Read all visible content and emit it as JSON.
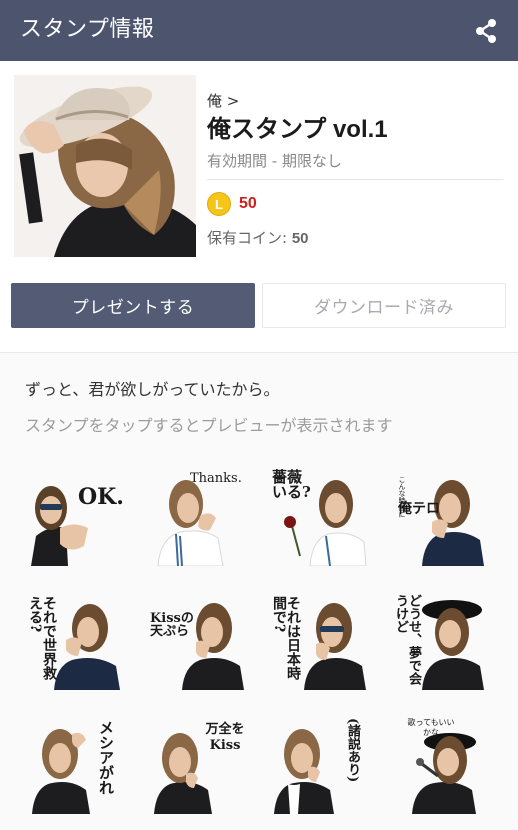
{
  "header": {
    "title": "スタンプ情報",
    "share_icon": "share-icon",
    "background": "#4c546e"
  },
  "product": {
    "author": "俺",
    "author_chevron": ">",
    "title": "俺スタンプ vol.1",
    "validity": "有効期間 - 期限なし",
    "coin_badge": "L",
    "price": "50",
    "holding_label": "保有コイン: ",
    "holding_value": "50",
    "price_color": "#cc2020"
  },
  "buttons": {
    "present": "プレゼントする",
    "downloaded": "ダウンロード済み"
  },
  "description": {
    "text": "ずっと、君が欲しがっていたから。",
    "hint": "スタンプをタップするとプレビューが表示されます"
  },
  "stickers": [
    {
      "caption": "OK."
    },
    {
      "caption": "Thanks."
    },
    {
      "caption": "薔薇いる?"
    },
    {
      "caption_small": "こんな時間に",
      "caption": "俺テロ"
    },
    {
      "caption": "それで世界救える?"
    },
    {
      "caption": "Kissの天ぷら"
    },
    {
      "caption": "それは日本時間で?"
    },
    {
      "caption": "どうせ、夢で会うけど"
    },
    {
      "caption": "メシアがれ"
    },
    {
      "caption": "万全をKiss"
    },
    {
      "caption": "(諸説あり)"
    },
    {
      "caption": "歌ってもいいかな"
    }
  ]
}
